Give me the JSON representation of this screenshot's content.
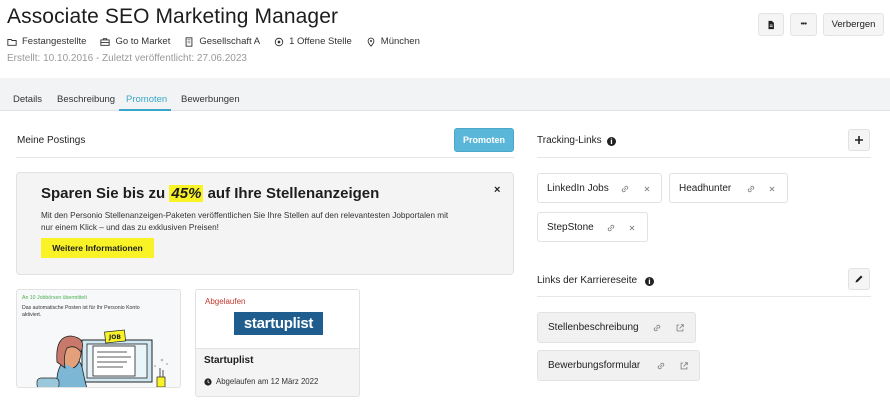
{
  "header": {
    "title": "Associate SEO Marketing Manager",
    "meta": [
      {
        "icon": "folder-icon",
        "label": "Festangestellte"
      },
      {
        "icon": "briefcase-icon",
        "label": "Go to Market"
      },
      {
        "icon": "building-icon",
        "label": "Gesellschaft A"
      },
      {
        "icon": "target-icon",
        "label": "1 Offene Stelle"
      },
      {
        "icon": "location-pin-icon",
        "label": "München"
      }
    ],
    "subline": "Erstellt: 10.10.2016 - Zuletzt veröffentlicht: 27.06.2023",
    "actions": {
      "more": "•••",
      "hide": "Verbergen"
    }
  },
  "tabs": [
    {
      "label": "Details",
      "active": false
    },
    {
      "label": "Beschreibung",
      "active": false
    },
    {
      "label": "Promoten",
      "active": true
    },
    {
      "label": "Bewerbungen",
      "active": false
    }
  ],
  "postings": {
    "title": "Meine Postings",
    "promote_button": "Promoten",
    "banner": {
      "title_before": "Sparen Sie bis zu",
      "title_highlight": "45%",
      "title_after": "auf Ihre Stellenanzeigen",
      "text": "Mit den Personio Stellenanzeigen-Paketen veröffentlichen Sie Ihre Stellen auf den relevantesten Jobportalen mit nur einem Klick – und das zu exklusiven Preisen!",
      "cta": "Weitere Informationen",
      "close": "×"
    },
    "illustration_card": {
      "status": "An 10 Jobbörsen übermittelt",
      "text": "Das automatische Posten ist für Ihr Personio Konto aktiviert.",
      "sticker": "JOB"
    },
    "startuplist_card": {
      "status": "Abgelaufen",
      "logo": "startuplist",
      "name": "Startuplist",
      "expired": "Abgelaufen am 12 März 2022"
    }
  },
  "tracking": {
    "title": "Tracking-Links",
    "info": "i",
    "links": [
      {
        "label": "LinkedIn Jobs"
      },
      {
        "label": "Headhunter"
      },
      {
        "label": "StepStone"
      }
    ]
  },
  "career": {
    "title": "Links der Karriereseite",
    "info": "i",
    "links": [
      {
        "label": "Stellenbeschreibung"
      },
      {
        "label": "Bewerbungsformular"
      }
    ]
  },
  "colors": {
    "accent": "#3aa6c9",
    "promo_button": "#5bb7d9",
    "highlight": "#f8f227",
    "expired": "#c0392b",
    "success": "#4caf50"
  }
}
